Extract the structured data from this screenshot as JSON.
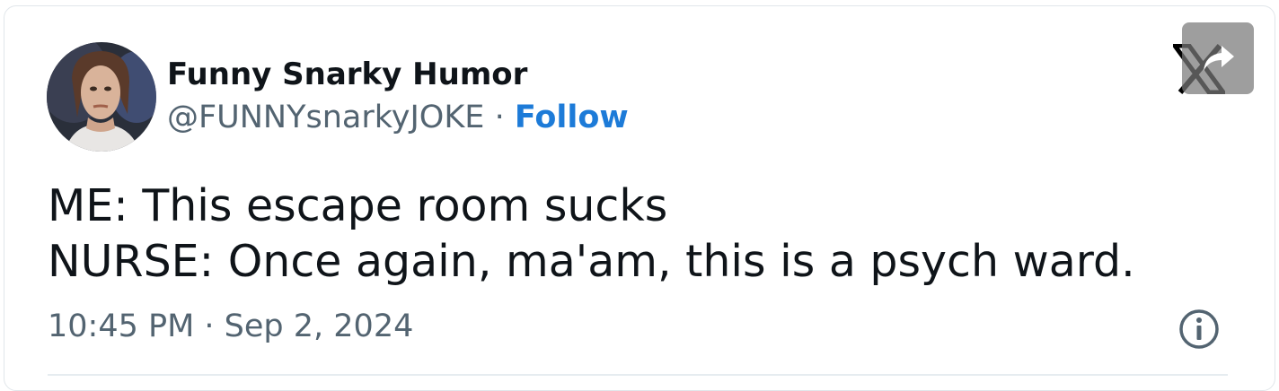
{
  "author": {
    "display_name": "Funny Snarky Humor",
    "handle": "@FUNNYsnarkyJOKE",
    "separator": "·",
    "follow_label": "Follow"
  },
  "tweet": {
    "lines": [
      "ME: This escape room sucks",
      "NURSE: Once again, ma'am, this is a psych ward."
    ],
    "timestamp": "10:45 PM · Sep 2, 2024"
  },
  "icons": {
    "platform_logo": "x-logo-icon",
    "share": "share-arrow-icon",
    "info": "info-icon"
  },
  "colors": {
    "follow": "#1d7bd8",
    "text": "#0f1419",
    "secondary": "#536471"
  }
}
